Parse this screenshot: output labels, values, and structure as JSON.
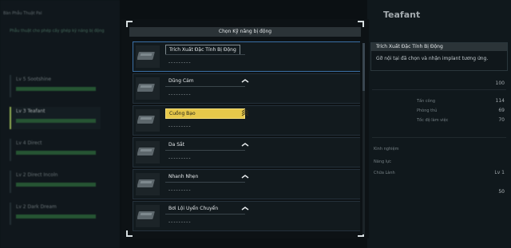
{
  "background": {
    "left_title": "Bàn Phẫu Thuật Pal",
    "left_subtitle": "Phẫu thuật cho phép cấy ghép kỹ năng bị động",
    "pals": [
      {
        "name": "Lv 5 Sootshine",
        "selected": false
      },
      {
        "name": "Lv 3 Teafant",
        "selected": true
      },
      {
        "name": "Lv 4 Direct",
        "selected": false
      },
      {
        "name": "Lv 2 Direct Incoln",
        "selected": false
      },
      {
        "name": "Lv 2 Dark Dream",
        "selected": false
      }
    ],
    "right_header": "Teafant",
    "stats": [
      {
        "label": "Tấn công",
        "value": "114"
      },
      {
        "label": "Phòng thủ",
        "value": "69"
      },
      {
        "label": "Tốc độ làm việc",
        "value": "70"
      }
    ],
    "stat_top": "100",
    "mini_labels": [
      "Kinh nghiệm",
      "Năng lực",
      "Chữa Lành",
      "Lv 1",
      "50"
    ]
  },
  "tooltip": {
    "title": "Trích Xuất Đặc Tính Bị Động",
    "description": "Gỡ nội tại đã chọn và nhận implant tương ứng."
  },
  "modal": {
    "title": "Chọn Kỹ năng bị động",
    "items": [
      {
        "name": "Trích Xuất Đặc Tính Bị Động",
        "sub": "---------",
        "style": "boxed",
        "rank_icon": "",
        "selected": true
      },
      {
        "name": "Dũng Cảm",
        "sub": "---------",
        "style": "plain",
        "rank_icon": "chevron-up-icon",
        "selected": false
      },
      {
        "name": "Cuồng Bạo",
        "sub": "---------",
        "style": "gold",
        "rank_icon": "triple-chevron-up-icon",
        "selected": false
      },
      {
        "name": "Da Sắt",
        "sub": "---------",
        "style": "plain",
        "rank_icon": "chevron-up-icon",
        "selected": false
      },
      {
        "name": "Nhanh Nhẹn",
        "sub": "---------",
        "style": "plain",
        "rank_icon": "chevron-up-icon",
        "selected": false
      },
      {
        "name": "Bơi Lội Uyển Chuyển",
        "sub": "---------",
        "style": "plain",
        "rank_icon": "chevron-up-icon",
        "selected": false
      }
    ]
  },
  "colors": {
    "gold_rank": "#e6c84a",
    "selection_blue": "#3a6fa5",
    "panel_bg": "#0d1215"
  }
}
